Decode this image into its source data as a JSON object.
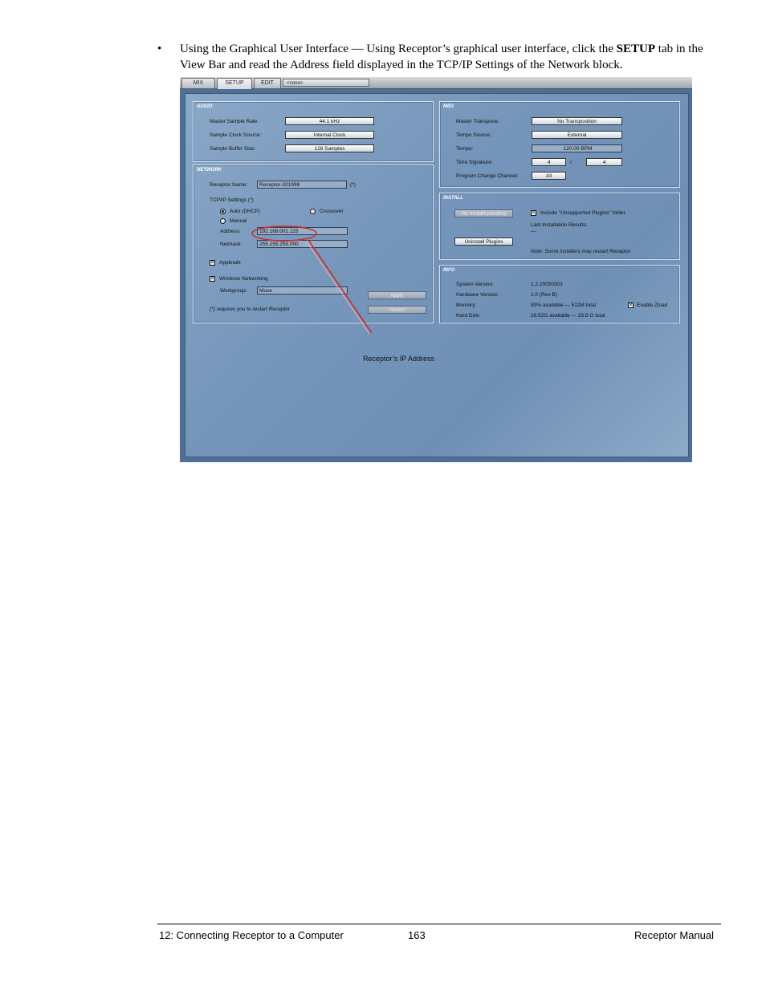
{
  "intro": {
    "bullet": "•",
    "text_before": "Using the Graphical User Interface — Using Receptor’s graphical user interface, click the ",
    "bold": "SETUP",
    "text_after": " tab in the View Bar and read the Address field displayed in the TCP/IP Settings of the Network block."
  },
  "viewbar": {
    "tabs": [
      "MIX",
      "SETUP",
      "EDIT"
    ],
    "active_tab": "SETUP",
    "selector": "<none>"
  },
  "audio": {
    "title": "AUDIO",
    "sample_rate_label": "Master Sample Rate:",
    "sample_rate_value": "44.1 kHz",
    "clock_source_label": "Sample Clock Source:",
    "clock_source_value": "Internal Clock",
    "buffer_size_label": "Sample Buffer Size:",
    "buffer_size_value": "128 Samples"
  },
  "midi": {
    "title": "MIDI",
    "transpose_label": "Master Transpose:",
    "transpose_value": "No Transposition",
    "tempo_source_label": "Tempo Source:",
    "tempo_source_value": "External",
    "tempo_label": "Tempo:",
    "tempo_value": "120.00 BPM",
    "time_sig_label": "Time Signature:",
    "time_sig_num": "4",
    "time_sig_sep": "/",
    "time_sig_den": "4",
    "program_change_label": "Program Change Channel:",
    "program_change_value": "All"
  },
  "network": {
    "title": "NETWORK",
    "receptor_name_label": "Receptor Name:",
    "receptor_name_value": "Receptor-201998",
    "restart_mark": "(*)",
    "tcpip_label": "TCP/IP Settings (*)",
    "auto_dhcp": "Auto (DHCP)",
    "crossover": "Crossover",
    "manual": "Manual",
    "address_label": "Address:",
    "address_value": "192.168.001.115",
    "netmask_label": "Netmask:",
    "netmask_value": "255.255.255.000",
    "appletalk": "Appletalk",
    "windows_networking": "Windows Networking",
    "workgroup_label": "Workgroup:",
    "workgroup_value": "Muse",
    "apply": "Apply",
    "revert": "Revert",
    "restart_note": "(*) requires you to restart Receptor"
  },
  "install": {
    "title": "INSTALL",
    "no_installs": "No installs pending",
    "include_unsupported": "Include \"Unsupported Plugins\" folder",
    "last_results_label": "Last Installation Results:",
    "last_results_value": "---",
    "uninstall": "Uninstall Plugins",
    "note": "Note: Some installers may restart Receptor"
  },
  "info": {
    "title": "INFO",
    "system_version_label": "System Version:",
    "system_version_value": "1.2.20050303",
    "hardware_version_label": "Hardware Version:",
    "hardware_version_value": "1.0 (Rev B)",
    "memory_label": "Memory:",
    "memory_value": "89% available — 512M total",
    "enable_zload": "Enable Zload",
    "hard_disk_label": "Hard Disk:",
    "hard_disk_value": "28.52G available — 33.8 G total"
  },
  "callout": "Receptor’s IP Address",
  "footer": {
    "chapter": "12: Connecting Receptor to a Computer",
    "page": "163",
    "manual": "Receptor Manual"
  },
  "colors": {
    "panel_bg": "#7595ba",
    "callout_line": "#cc2a2a"
  }
}
